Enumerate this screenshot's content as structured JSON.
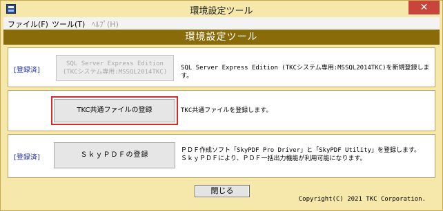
{
  "window": {
    "title": "環境設定ツール",
    "close_glyph": "✕"
  },
  "menu": [
    {
      "label": "ファイル(F)",
      "enabled": true
    },
    {
      "label": "ツール(T)",
      "enabled": true
    },
    {
      "label": "ﾍﾙﾌﾟ(H)",
      "enabled": false
    }
  ],
  "header": {
    "title": "環境設定ツール"
  },
  "panels": [
    {
      "status": "[登録済]",
      "button_line1": "SQL Server Express Edition",
      "button_line2": "(TKCシステム専用:MSSQL2014TKC)",
      "button_enabled": false,
      "description_line1": "SQL Server Express Edition (TKCシステム専用:MSSQL2014TKC)を新規登録します。",
      "description_line2": ""
    },
    {
      "status": "",
      "button_label": "TKC共通ファイルの登録",
      "button_enabled": true,
      "highlighted": true,
      "description_line1": "TKC共通ファイルを登録します。",
      "description_line2": ""
    },
    {
      "status": "[登録済]",
      "button_label": "ＳｋｙＰＤＦの登録",
      "button_enabled": true,
      "description_line1": "ＰＤＦ作成ソフト「SkyPDF Pro Driver」と「SkyPDF Utility」を登録します。",
      "description_line2": "ＳｋｙＰＤＦにより、ＰＤＦ一括出力機能が利用可能になります。"
    }
  ],
  "footer": {
    "close_label": "閉じる",
    "copyright": "Copyright(C) 2021 TKC Corporation."
  },
  "colors": {
    "background": "#f6e8ab",
    "header": "#8a6b0a",
    "status_text": "#1c2aa8",
    "highlight": "#d42a2a",
    "window_close": "#c7453b"
  },
  "icons": {
    "app": "app-icon",
    "close": "close-icon"
  }
}
